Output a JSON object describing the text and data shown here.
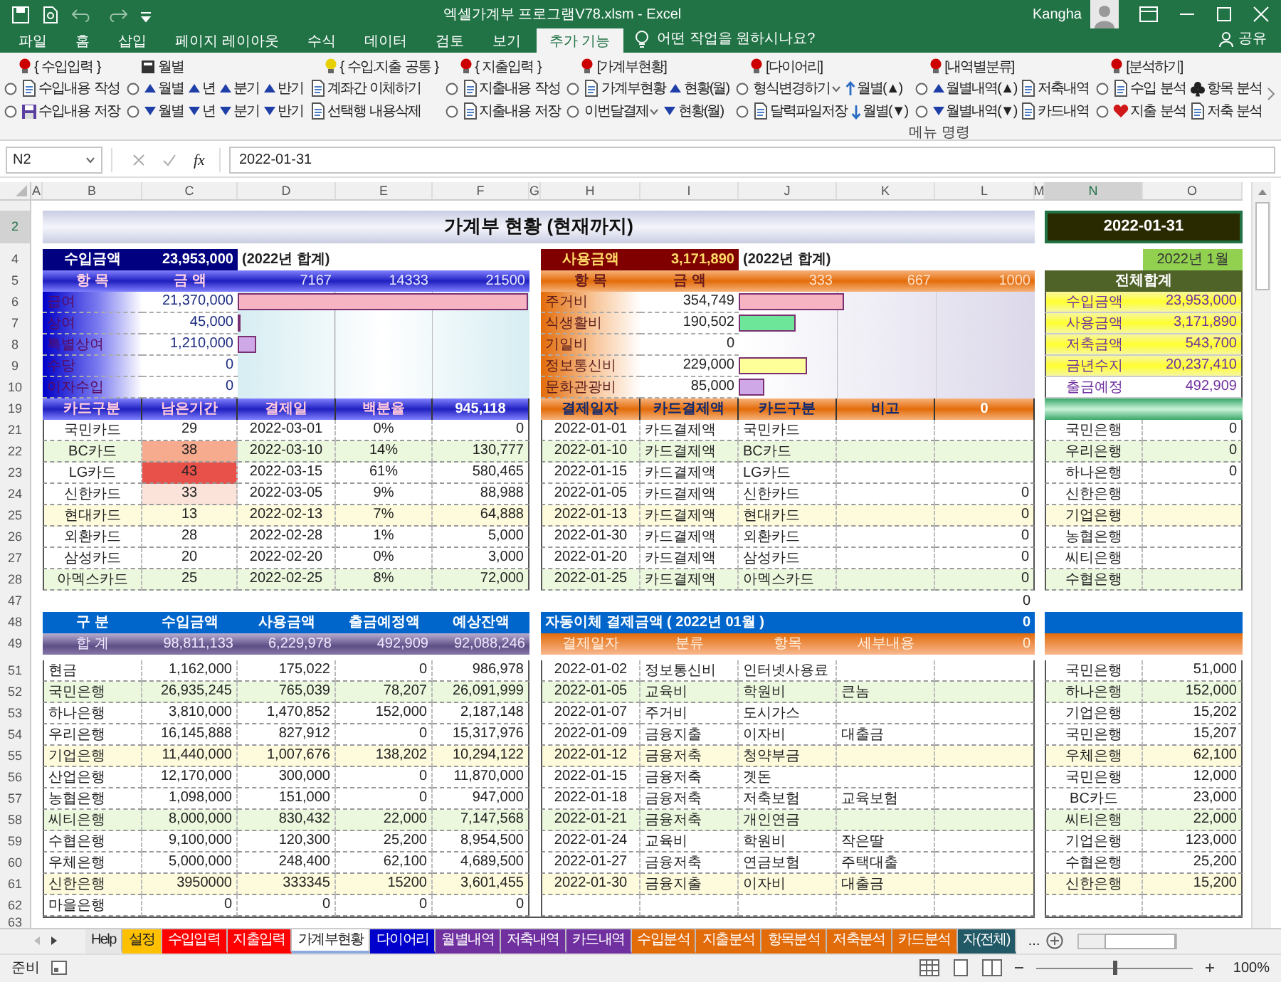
{
  "window": {
    "title": "엑셀가계부 프로그램V78.xlsm  -  Excel",
    "user": "Kangha"
  },
  "ribbon_tabs": [
    {
      "label": "파일",
      "selected": false
    },
    {
      "label": "홈",
      "selected": false
    },
    {
      "label": "삽입",
      "selected": false
    },
    {
      "label": "페이지 레이아웃",
      "selected": false
    },
    {
      "label": "수식",
      "selected": false
    },
    {
      "label": "데이터",
      "selected": false
    },
    {
      "label": "검토",
      "selected": false
    },
    {
      "label": "보기",
      "selected": false
    },
    {
      "label": "추가 기능",
      "selected": true
    }
  ],
  "tell_me": "어떤 작업을 원하시나요?",
  "share": "공유",
  "ribbon_groups": [
    {
      "title": "{ 수입입력 }",
      "color": "#cc0000",
      "radio": true,
      "rows": [
        [
          {
            "label": "수입내용 작성",
            "kind": "doc"
          }
        ],
        [
          {
            "label": "수입내용 저장",
            "kind": "disk"
          }
        ]
      ]
    },
    {
      "title": "월별",
      "radio": true,
      "rows": [
        [
          {
            "label": "월별",
            "kind": "up"
          },
          {
            "label": "년",
            "kind": "up"
          },
          {
            "label": "분기",
            "kind": "up"
          },
          {
            "label": "반기",
            "kind": "up"
          }
        ],
        [
          {
            "label": "월별",
            "kind": "down"
          },
          {
            "label": "년",
            "kind": "down"
          },
          {
            "label": "분기",
            "kind": "down"
          },
          {
            "label": "반기",
            "kind": "down"
          }
        ]
      ]
    },
    {
      "title": "{ 수입.지출 공통 }",
      "color": "#e8d000",
      "rows": [
        [
          {
            "label": "계좌간 이체하기",
            "kind": "doc"
          }
        ],
        [
          {
            "label": "선택행 내용삭제",
            "kind": "doc"
          }
        ]
      ]
    },
    {
      "title": "{ 지출입력 }",
      "color": "#cc0000",
      "radio": true,
      "rows": [
        [
          {
            "label": "지출내용 작성",
            "kind": "doc"
          }
        ],
        [
          {
            "label": "지출내용 저장",
            "kind": "doc"
          }
        ]
      ]
    },
    {
      "title": "[가계부현황]",
      "color": "#cc0000",
      "radio": true,
      "rows": [
        [
          {
            "label": "가계부현황",
            "kind": "doc"
          },
          {
            "label": "현황(월)",
            "kind": "up"
          }
        ],
        [
          {
            "label": "이번달결제",
            "kind": "dropdown"
          },
          {
            "label": "현황(월)",
            "kind": "down"
          }
        ]
      ]
    },
    {
      "title": "[다이어리]",
      "color": "#cc0000",
      "radio": true,
      "rows": [
        [
          {
            "label": "형식변경하기",
            "kind": "dropdown"
          },
          {
            "label": "월별(▲)",
            "kind": "arrow-up"
          }
        ],
        [
          {
            "label": "달력파일저장",
            "kind": "doc"
          },
          {
            "label": "월별(▼)",
            "kind": "arrow-down"
          }
        ]
      ]
    },
    {
      "title": "[내역별분류]",
      "color": "#cc0000",
      "radio": true,
      "rows": [
        [
          {
            "label": "월별내역(▲)",
            "kind": "up"
          },
          {
            "label": "저축내역",
            "kind": "doc"
          }
        ],
        [
          {
            "label": "월별내역(▼)",
            "kind": "down"
          },
          {
            "label": "카드내역",
            "kind": "doc"
          }
        ]
      ]
    },
    {
      "title": "[분석하기]",
      "color": "#cc0000",
      "radio": true,
      "rows": [
        [
          {
            "label": "수입 분석",
            "kind": "doc"
          },
          {
            "label": "항목 분석",
            "kind": "clubs"
          }
        ],
        [
          {
            "label": "지출 분석",
            "kind": "heart"
          },
          {
            "label": "저축 분석",
            "kind": "doc"
          }
        ]
      ]
    }
  ],
  "ribbon_footer": "메뉴 명령",
  "formula_bar": {
    "name_box": "N2",
    "fx": "fx",
    "value": "2022-01-31"
  },
  "columns": [
    {
      "label": "A",
      "selected": false
    },
    {
      "label": "B",
      "selected": false
    },
    {
      "label": "C",
      "selected": false
    },
    {
      "label": "D",
      "selected": false
    },
    {
      "label": "E",
      "selected": false
    },
    {
      "label": "F",
      "selected": false
    },
    {
      "label": "G",
      "selected": false
    },
    {
      "label": "H",
      "selected": false
    },
    {
      "label": "I",
      "selected": false
    },
    {
      "label": "J",
      "selected": false
    },
    {
      "label": "K",
      "selected": false
    },
    {
      "label": "L",
      "selected": false
    },
    {
      "label": "M",
      "selected": false
    },
    {
      "label": "N",
      "selected": true
    },
    {
      "label": "O",
      "selected": false
    }
  ],
  "row_numbers": [
    {
      "label": "2",
      "selected": true
    },
    {
      "label": "4",
      "selected": false
    },
    {
      "label": "5",
      "selected": false
    },
    {
      "label": "6",
      "selected": false
    },
    {
      "label": "7",
      "selected": false
    },
    {
      "label": "8",
      "selected": false
    },
    {
      "label": "9",
      "selected": false
    },
    {
      "label": "10",
      "selected": false
    },
    {
      "label": "19",
      "selected": false
    },
    {
      "label": "21",
      "selected": false
    },
    {
      "label": "22",
      "selected": false
    },
    {
      "label": "23",
      "selected": false
    },
    {
      "label": "24",
      "selected": false
    },
    {
      "label": "25",
      "selected": false
    },
    {
      "label": "26",
      "selected": false
    },
    {
      "label": "27",
      "selected": false
    },
    {
      "label": "28",
      "selected": false
    },
    {
      "label": "47",
      "selected": false
    },
    {
      "label": "48",
      "selected": false
    },
    {
      "label": "49",
      "selected": false
    },
    {
      "label": "51",
      "selected": false
    },
    {
      "label": "52",
      "selected": false
    },
    {
      "label": "53",
      "selected": false
    },
    {
      "label": "54",
      "selected": false
    },
    {
      "label": "55",
      "selected": false
    },
    {
      "label": "56",
      "selected": false
    },
    {
      "label": "57",
      "selected": false
    },
    {
      "label": "58",
      "selected": false
    },
    {
      "label": "59",
      "selected": false
    },
    {
      "label": "60",
      "selected": false
    },
    {
      "label": "61",
      "selected": false
    },
    {
      "label": "62",
      "selected": false
    },
    {
      "label": "63",
      "selected": false
    }
  ],
  "sheet": {
    "title": "가계부 현황 (현재까지)",
    "date": "2022-01-31",
    "month": "2022년 1월",
    "income": {
      "label": "수입금액",
      "amount": "23,953,000",
      "note": "(2022년 합계)",
      "headers": [
        "항 목",
        "금 액"
      ],
      "ticks": [
        "7167",
        "14333",
        "21500"
      ],
      "items": [
        {
          "name": "급여",
          "amount": "21,370,000",
          "level": 0.994,
          "color": "#f6b3c2"
        },
        {
          "name": "상여",
          "amount": "45,000",
          "level": 0.004
        },
        {
          "name": "특별상여",
          "amount": "1,210,000",
          "level": 0.065,
          "color": "#cfa8e8"
        },
        {
          "name": "수당",
          "amount": "0",
          "level": 0
        },
        {
          "name": "이자수입",
          "amount": "0",
          "level": 0
        }
      ]
    },
    "expense": {
      "label": "사용금액",
      "amount": "3,171,890",
      "note": "(2022년 합계)",
      "headers": [
        "항 목",
        "금 액"
      ],
      "ticks": [
        "333",
        "667",
        "1000"
      ],
      "items": [
        {
          "name": "주거비",
          "amount": "354,749",
          "level": 0.355,
          "color": "#f6b3c2"
        },
        {
          "name": "식생활비",
          "amount": "190,502",
          "level": 0.19,
          "color": "#6ee69a"
        },
        {
          "name": "기일비",
          "amount": "0",
          "level": 0
        },
        {
          "name": "정보통신비",
          "amount": "229,000",
          "level": 0.229,
          "color": "#ffff99"
        },
        {
          "name": "문화관광비",
          "amount": "85,000",
          "level": 0.085,
          "color": "#cfa8e8"
        }
      ]
    },
    "summary": {
      "title": "전체합계",
      "items": [
        {
          "label": "수입금액",
          "value": "23,953,000",
          "highlighted": true
        },
        {
          "label": "사용금액",
          "value": "3,171,890",
          "highlighted": true
        },
        {
          "label": "저축금액",
          "value": "543,700",
          "highlighted": true
        },
        {
          "label": "금년수지",
          "value": "20,237,410",
          "highlighted": true
        },
        {
          "label": "출금예정",
          "value": "492,909",
          "highlighted": false
        }
      ]
    },
    "cards": {
      "headers": [
        "카드구분",
        "남은기간",
        "결제일",
        "백분율",
        "945,118"
      ],
      "rows": [
        {
          "card": "국민카드",
          "remaining": {
            "value": "29"
          },
          "date": "2022-03-01",
          "percent": "0%",
          "amount": "0",
          "color": "#ffffff"
        },
        {
          "card": "BC카드",
          "remaining": {
            "value": "38",
            "color": "#f7ab8e"
          },
          "date": "2022-03-10",
          "percent": "14%",
          "amount": "130,777",
          "color": "#ecf8de"
        },
        {
          "card": "LG카드",
          "remaining": {
            "value": "43",
            "color": "#e8504a"
          },
          "date": "2022-03-15",
          "percent": "61%",
          "amount": "580,465",
          "color": "#ffffff"
        },
        {
          "card": "신한카드",
          "remaining": {
            "value": "33",
            "color": "#fbe3da"
          },
          "date": "2022-03-05",
          "percent": "9%",
          "amount": "88,988",
          "color": "#ffffff"
        },
        {
          "card": "현대카드",
          "remaining": {
            "value": "13"
          },
          "date": "2022-02-13",
          "percent": "7%",
          "amount": "64,888",
          "color": "#fdfbdc"
        },
        {
          "card": "외환카드",
          "remaining": {
            "value": "28"
          },
          "date": "2022-02-28",
          "percent": "1%",
          "amount": "5,000",
          "color": "#ffffff"
        },
        {
          "card": "삼성카드",
          "remaining": {
            "value": "20"
          },
          "date": "2022-02-20",
          "percent": "0%",
          "amount": "3,000",
          "color": "#ffffff"
        },
        {
          "card": "아멕스카드",
          "remaining": {
            "value": "25"
          },
          "date": "2022-02-25",
          "percent": "8%",
          "amount": "72,000",
          "color": "#ecf8de"
        }
      ]
    },
    "payments": {
      "headers": [
        "결제일자",
        "카드결제액",
        "카드구분",
        "비고",
        "0"
      ],
      "rows": [
        {
          "date": "2022-01-01",
          "type": "카드결제액",
          "card": "국민카드",
          "bank": "국민은행",
          "bank_value": "0"
        },
        {
          "date": "2022-01-10",
          "type": "카드결제액",
          "card": "BC카드",
          "bank": "우리은행",
          "bank_value": "0"
        },
        {
          "date": "2022-01-15",
          "type": "카드결제액",
          "card": "LG카드",
          "bank": "하나은행",
          "bank_value": "0"
        },
        {
          "date": "2022-01-05",
          "type": "카드결제액",
          "card": "신한카드",
          "total": "0",
          "bank": "신한은행"
        },
        {
          "date": "2022-01-13",
          "type": "카드결제액",
          "card": "현대카드",
          "total": "0",
          "bank": "기업은행"
        },
        {
          "date": "2022-01-30",
          "type": "카드결제액",
          "card": "외환카드",
          "total": "0",
          "bank": "농협은행"
        },
        {
          "date": "2022-01-20",
          "type": "카드결제액",
          "card": "삼성카드",
          "total": "0",
          "bank": "씨티은행"
        },
        {
          "date": "2022-01-25",
          "type": "카드결제액",
          "card": "아멕스카드",
          "total": "0",
          "bank": "수협은행"
        }
      ]
    },
    "row47_value": "0",
    "accounts": {
      "headers": [
        "구  분",
        "수입금액",
        "사용금액",
        "출금예정액",
        "예상잔액"
      ],
      "total": [
        "합  계",
        "98,811,133",
        "6,229,978",
        "492,909",
        "92,088,246"
      ],
      "rows": [
        {
          "name": "현금",
          "income": "1,162,000",
          "spent": "175,022",
          "planned": "0",
          "balance": "986,978",
          "color": "#ffffff"
        },
        {
          "name": "국민은행",
          "income": "26,935,245",
          "spent": "765,039",
          "planned": "78,207",
          "balance": "26,091,999",
          "color": "#ecf8de"
        },
        {
          "name": "하나은행",
          "income": "3,810,000",
          "spent": "1,470,852",
          "planned": "152,000",
          "balance": "2,187,148",
          "color": "#ffffff"
        },
        {
          "name": "우리은행",
          "income": "16,145,888",
          "spent": "827,912",
          "planned": "0",
          "balance": "15,317,976",
          "color": "#ffffff"
        },
        {
          "name": "기업은행",
          "income": "11,440,000",
          "spent": "1,007,676",
          "planned": "138,202",
          "balance": "10,294,122",
          "color": "#fdfbdc"
        },
        {
          "name": "산업은행",
          "income": "12,170,000",
          "spent": "300,000",
          "planned": "0",
          "balance": "11,870,000",
          "color": "#ffffff"
        },
        {
          "name": "농협은행",
          "income": "1,098,000",
          "spent": "151,000",
          "planned": "0",
          "balance": "947,000",
          "color": "#ffffff"
        },
        {
          "name": "씨티은행",
          "income": "8,000,000",
          "spent": "830,432",
          "planned": "22,000",
          "balance": "7,147,568",
          "color": "#ecf8de"
        },
        {
          "name": "수협은행",
          "income": "9,100,000",
          "spent": "120,300",
          "planned": "25,200",
          "balance": "8,954,500",
          "color": "#ffffff"
        },
        {
          "name": "우체은행",
          "income": "5,000,000",
          "spent": "248,400",
          "planned": "62,100",
          "balance": "4,689,500",
          "color": "#ffffff"
        },
        {
          "name": "신한은행",
          "income": "3950000",
          "spent": "333345",
          "planned": "15200",
          "balance": "3,601,455",
          "color": "#fdfbdc"
        },
        {
          "name": "마을은행",
          "income": "0",
          "spent": "0",
          "planned": "0",
          "balance": "0",
          "color": "#ffffff"
        }
      ]
    },
    "transfers": {
      "title": "자동이체 결제금액 ( 2022년 01월 )",
      "title_value": "0",
      "headers": [
        "결제일자",
        "분류",
        "항목",
        "세부내용",
        "0"
      ],
      "rows": [
        {
          "date": "2022-01-02",
          "category": "정보통신비",
          "item": "인터넷사용료",
          "bank": "국민은행",
          "amount": "51,000"
        },
        {
          "date": "2022-01-05",
          "category": "교육비",
          "item": "학원비",
          "detail": "큰놈",
          "bank": "하나은행",
          "amount": "152,000"
        },
        {
          "date": "2022-01-07",
          "category": "주거비",
          "item": "도시가스",
          "bank": "기업은행",
          "amount": "15,202"
        },
        {
          "date": "2022-01-09",
          "category": "금융지출",
          "item": "이자비",
          "detail": "대출금",
          "bank": "국민은행",
          "amount": "15,207"
        },
        {
          "date": "2022-01-12",
          "category": "금융저축",
          "item": "청약부금",
          "bank": "우체은행",
          "amount": "62,100"
        },
        {
          "date": "2022-01-15",
          "category": "금융저축",
          "item": "곗돈",
          "bank": "국민은행",
          "amount": "12,000"
        },
        {
          "date": "2022-01-18",
          "category": "금융저축",
          "item": "저축보험",
          "detail": "교육보험",
          "bank": "BC카드",
          "amount": "23,000"
        },
        {
          "date": "2022-01-21",
          "category": "금융저축",
          "item": "개인연금",
          "bank": "씨티은행",
          "amount": "22,000"
        },
        {
          "date": "2022-01-24",
          "category": "교육비",
          "item": "학원비",
          "detail": "작은딸",
          "bank": "기업은행",
          "amount": "123,000"
        },
        {
          "date": "2022-01-27",
          "category": "금융저축",
          "item": "연금보험",
          "detail": "주택대출",
          "bank": "수협은행",
          "amount": "25,200"
        },
        {
          "date": "2022-01-30",
          "category": "금융지출",
          "item": "이자비",
          "detail": "대출금",
          "bank": "신한은행",
          "amount": "15,200"
        }
      ]
    }
  },
  "sheet_tabs": [
    {
      "label": "Help",
      "selected": false
    },
    {
      "label": "설정",
      "selected": false,
      "color": "#ffc000"
    },
    {
      "label": "수입입력",
      "selected": false,
      "color": "#ff0000"
    },
    {
      "label": "지출입력",
      "selected": false,
      "color": "#ff0000"
    },
    {
      "label": "가계부현황",
      "selected": true,
      "color": "#8ea9db"
    },
    {
      "label": "다이어리",
      "selected": false,
      "color": "#0000cc"
    },
    {
      "label": "월별내역",
      "selected": false,
      "color": "#7030a0"
    },
    {
      "label": "저축내역",
      "selected": false,
      "color": "#7030a0"
    },
    {
      "label": "카드내역",
      "selected": false,
      "color": "#7030a0"
    },
    {
      "label": "수입분석",
      "selected": false,
      "color": "#e26b0a"
    },
    {
      "label": "지출분석",
      "selected": false,
      "color": "#e26b0a"
    },
    {
      "label": "항목분석",
      "selected": false,
      "color": "#e26b0a"
    },
    {
      "label": "저축분석",
      "selected": false,
      "color": "#e26b0a"
    },
    {
      "label": "카드분석",
      "selected": false,
      "color": "#e26b0a"
    },
    {
      "label": "자(전체)",
      "selected": false,
      "color": "#215967"
    }
  ],
  "tabs_more": "...",
  "status": {
    "text": "준비",
    "zoom": "100%",
    "level": 0.5
  }
}
